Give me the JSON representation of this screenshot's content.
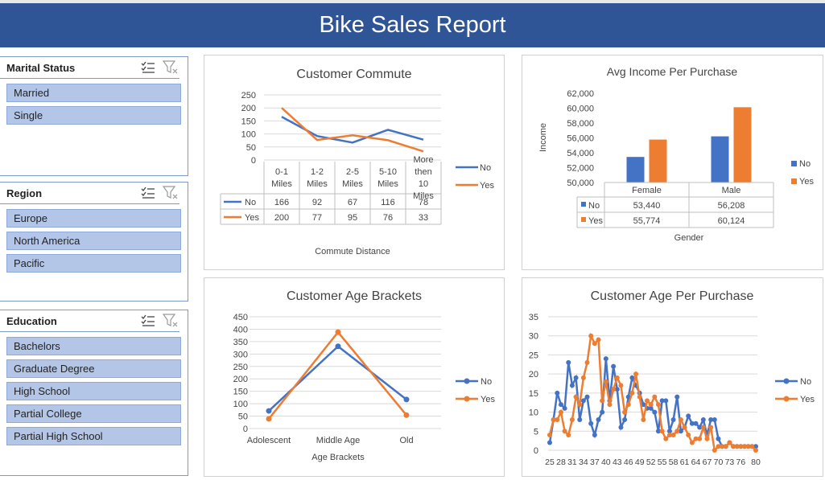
{
  "report_title": "Bike Sales Report",
  "colors": {
    "no": "#4472c4",
    "yes": "#ed7d31",
    "banner": "#2f5597",
    "slicer_item": "#b4c6e7"
  },
  "slicers": {
    "marital": {
      "title": "Marital Status",
      "items": [
        "Married",
        "Single"
      ]
    },
    "region": {
      "title": "Region",
      "items": [
        "Europe",
        "North America",
        "Pacific"
      ]
    },
    "education": {
      "title": "Education",
      "items": [
        "Bachelors",
        "Graduate Degree",
        "High School",
        "Partial College",
        "Partial High School"
      ]
    },
    "icons": [
      "multi-select-icon",
      "clear-filter-icon"
    ]
  },
  "chart_data": [
    {
      "id": "commute",
      "type": "line",
      "title": "Customer Commute",
      "xlabel": "Commute Distance",
      "ylabel": "",
      "categories": [
        "0-1 Miles",
        "1-2 Miles",
        "2-5 Miles",
        "5-10 Miles",
        "More then 10 Miles"
      ],
      "yticks": [
        "250",
        "200",
        "150",
        "100",
        "50",
        "0"
      ],
      "ylim": [
        0,
        250
      ],
      "series": [
        {
          "name": "No",
          "values": [
            166,
            92,
            67,
            116,
            78
          ]
        },
        {
          "name": "Yes",
          "values": [
            200,
            77,
            95,
            76,
            33
          ]
        }
      ],
      "legend": "right",
      "data_table": true
    },
    {
      "id": "income",
      "type": "bar",
      "title": "Avg Income Per Purchase",
      "xlabel": "Gender",
      "ylabel": "Income",
      "categories": [
        "Female",
        "Male"
      ],
      "yticks": [
        "62,000",
        "60,000",
        "58,000",
        "56,000",
        "54,000",
        "52,000",
        "50,000"
      ],
      "ylim": [
        50000,
        62000
      ],
      "series": [
        {
          "name": "No",
          "values": [
            53440,
            56208
          ],
          "labels": [
            "53,440",
            "56,208"
          ]
        },
        {
          "name": "Yes",
          "values": [
            55774,
            60124
          ],
          "labels": [
            "55,774",
            "60,124"
          ]
        }
      ],
      "legend": "right",
      "data_table": true
    },
    {
      "id": "brackets",
      "type": "line",
      "title": "Customer Age Brackets",
      "xlabel": "Age Brackets",
      "ylabel": "",
      "categories": [
        "Adolescent",
        "Middle Age",
        "Old"
      ],
      "yticks": [
        "450",
        "400",
        "350",
        "300",
        "250",
        "200",
        "150",
        "100",
        "50",
        "0"
      ],
      "ylim": [
        0,
        450
      ],
      "series": [
        {
          "name": "No",
          "values": [
            71,
            331,
            117
          ]
        },
        {
          "name": "Yes",
          "values": [
            39,
            388,
            54
          ]
        }
      ],
      "legend": "right"
    },
    {
      "id": "age",
      "type": "line",
      "title": "Customer Age Per Purchase",
      "xlabel": "",
      "ylabel": "",
      "x": [
        25,
        26,
        27,
        28,
        29,
        30,
        31,
        32,
        33,
        34,
        35,
        36,
        37,
        38,
        39,
        40,
        41,
        42,
        43,
        44,
        45,
        46,
        47,
        48,
        49,
        50,
        51,
        52,
        53,
        54,
        55,
        56,
        57,
        58,
        59,
        60,
        61,
        62,
        63,
        64,
        65,
        66,
        67,
        68,
        69,
        70,
        71,
        72,
        73,
        74,
        75,
        76,
        77,
        78,
        79,
        80
      ],
      "xticks": [
        "25",
        "28",
        "31",
        "34",
        "37",
        "40",
        "43",
        "46",
        "49",
        "52",
        "55",
        "58",
        "61",
        "64",
        "67",
        "70",
        "73",
        "76",
        "80"
      ],
      "yticks": [
        "35",
        "30",
        "25",
        "20",
        "15",
        "10",
        "5",
        "0"
      ],
      "ylim": [
        0,
        35
      ],
      "series": [
        {
          "name": "No",
          "values": [
            2,
            8,
            15,
            12,
            11,
            23,
            17,
            19,
            8,
            13,
            14,
            7,
            4,
            8,
            10,
            24,
            13,
            22,
            16,
            6,
            8,
            14,
            19,
            17,
            15,
            12,
            11,
            11,
            10,
            5,
            13,
            13,
            5,
            8,
            14,
            5,
            6,
            9,
            7,
            7,
            6,
            8,
            4,
            8,
            8,
            3,
            1,
            1,
            2,
            1,
            1,
            1,
            1,
            1,
            1,
            1
          ]
        },
        {
          "name": "Yes",
          "values": [
            4,
            8,
            8,
            10,
            5,
            4,
            8,
            14,
            12,
            19,
            23,
            30,
            28,
            29,
            13,
            18,
            12,
            16,
            19,
            17,
            10,
            12,
            15,
            20,
            14,
            8,
            13,
            12,
            14,
            12,
            5,
            3,
            4,
            4,
            5,
            8,
            6,
            4,
            2,
            3,
            3,
            6,
            3,
            6,
            0,
            1,
            1,
            1,
            2,
            1,
            1,
            1,
            1,
            1,
            1,
            0
          ]
        }
      ],
      "legend": "right"
    }
  ]
}
